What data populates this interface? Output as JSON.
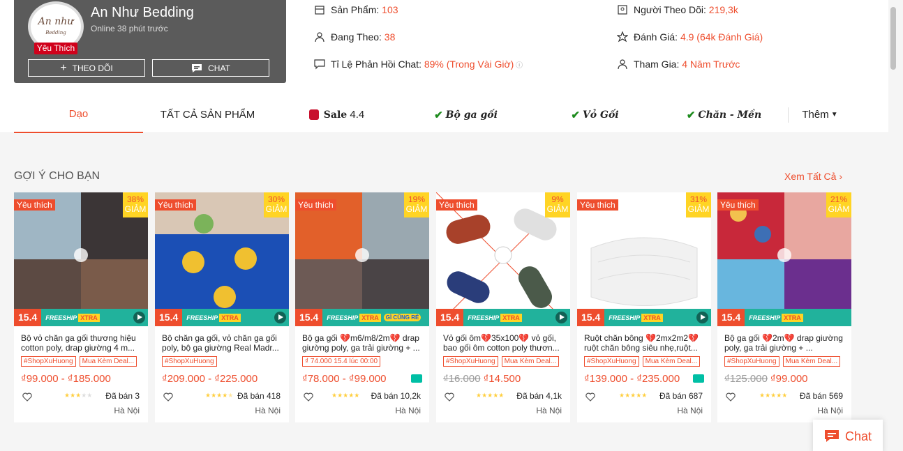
{
  "shop": {
    "name": "An Như Bedding",
    "online": "Online 38 phút trước",
    "badge": "Yêu Thích",
    "follow_label": "THEO DÕI",
    "chat_label": "CHAT"
  },
  "stats": {
    "products_label": "Sản Phẩm:",
    "products_value": "103",
    "following_label": "Đang Theo:",
    "following_value": "38",
    "chat_rate_label": "Tỉ Lệ Phản Hồi Chat:",
    "chat_rate_value": "89% (Trong Vài Giờ)",
    "followers_label": "Người Theo Dõi:",
    "followers_value": "219,3k",
    "rating_label": "Đánh Giá:",
    "rating_value": "4.9 (64k Đánh Giá)",
    "joined_label": "Tham Gia:",
    "joined_value": "4 Năm Trước"
  },
  "tabs": {
    "t1": "Dạo",
    "t2": "TẤT CẢ SẢN PHẨM",
    "t3_bold": "Sale",
    "t3_rest": "4.4",
    "t4": "Bộ ga gối",
    "t5": "Vỏ Gối",
    "t6": "Chăn - Mền",
    "more": "Thêm"
  },
  "section": {
    "title": "GỢI Ý CHO BẠN",
    "see_all": "Xem Tất Cả"
  },
  "common": {
    "fav": "Yêu thích",
    "giam": "GIẢM",
    "day": "15.4",
    "freeship": "FREESHIP",
    "xtra": "XTRA",
    "tag1": "#ShopXuHuong",
    "tag2": "Mua Kèm Deal..."
  },
  "products": [
    {
      "discount": "38%",
      "name": "Bộ vỏ chăn ga gối thương hiệu cotton poly, drap giường 4 m...",
      "price": "₫99.000 - ₫185.000",
      "old": "",
      "sold": "Đã bán 3",
      "loc": "Hà Nội",
      "rating": 3
    },
    {
      "discount": "30%",
      "name": "Bộ chăn ga gối, vỏ chăn ga gối poly, bộ ga giường Real Madr...",
      "price": "₫209.000 - ₫225.000",
      "old": "",
      "sold": "Đã bán 418",
      "loc": "Hà Nội",
      "rating": 4.5
    },
    {
      "discount": "19%",
      "name": "Bộ ga gối 💔m6/m8/2m💔 drap giường poly, ga trải giường + ...",
      "price": "₫78.000 - ₫99.000",
      "old": "",
      "tag_special": "₫ 74.000 15.4 lúc 00:00",
      "sold": "Đã bán 10,2k",
      "loc": "Hà Nội",
      "rating": 5,
      "extra_promo": "GÌ CŨNG RẺ"
    },
    {
      "discount": "9%",
      "name": "Vỏ gối ôm💔35x100💔 vỏ gối, bao gối ôm cotton poly thươn...",
      "price": "₫14.500",
      "old": "₫16.000",
      "sold": "Đã bán 4,1k",
      "loc": "Hà Nội",
      "rating": 5
    },
    {
      "discount": "31%",
      "name": "Ruột chăn bông 💔2mx2m2💔 ruột chăn bông siêu nhẹ,ruột...",
      "price": "₫139.000 - ₫235.000",
      "old": "",
      "sold": "Đã bán 687",
      "loc": "Hà Nội",
      "rating": 5
    },
    {
      "discount": "21%",
      "name": "Bộ ga gối 💔2m💔 drap giường poly, ga trải giường + ...",
      "price": "₫99.000",
      "old": "₫125.000",
      "sold": "Đã bán 569",
      "loc": "Hà Nội",
      "rating": 5
    }
  ],
  "chat_fab": "Chat",
  "colors": {
    "accent": "#ee4d2d",
    "freeship": "#21b29c",
    "discount_bg": "#ffd424"
  }
}
